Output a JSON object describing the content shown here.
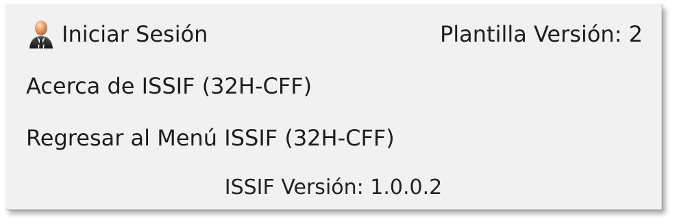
{
  "menu": {
    "login": {
      "label": "Iniciar Sesión",
      "icon": "user-icon"
    },
    "about": {
      "label": "Acerca de ISSIF (32H-CFF)"
    },
    "return": {
      "label": "Regresar al Menú ISSIF (32H-CFF)"
    }
  },
  "info": {
    "template_version": "Plantilla Versión: 2",
    "issif_version": "ISSIF Versión: 1.0.0.2"
  },
  "colors": {
    "panel_background": "#f1f1f1",
    "text": "#1d1d1d",
    "user_head": "#d78a5a",
    "user_suit": "#202020"
  }
}
